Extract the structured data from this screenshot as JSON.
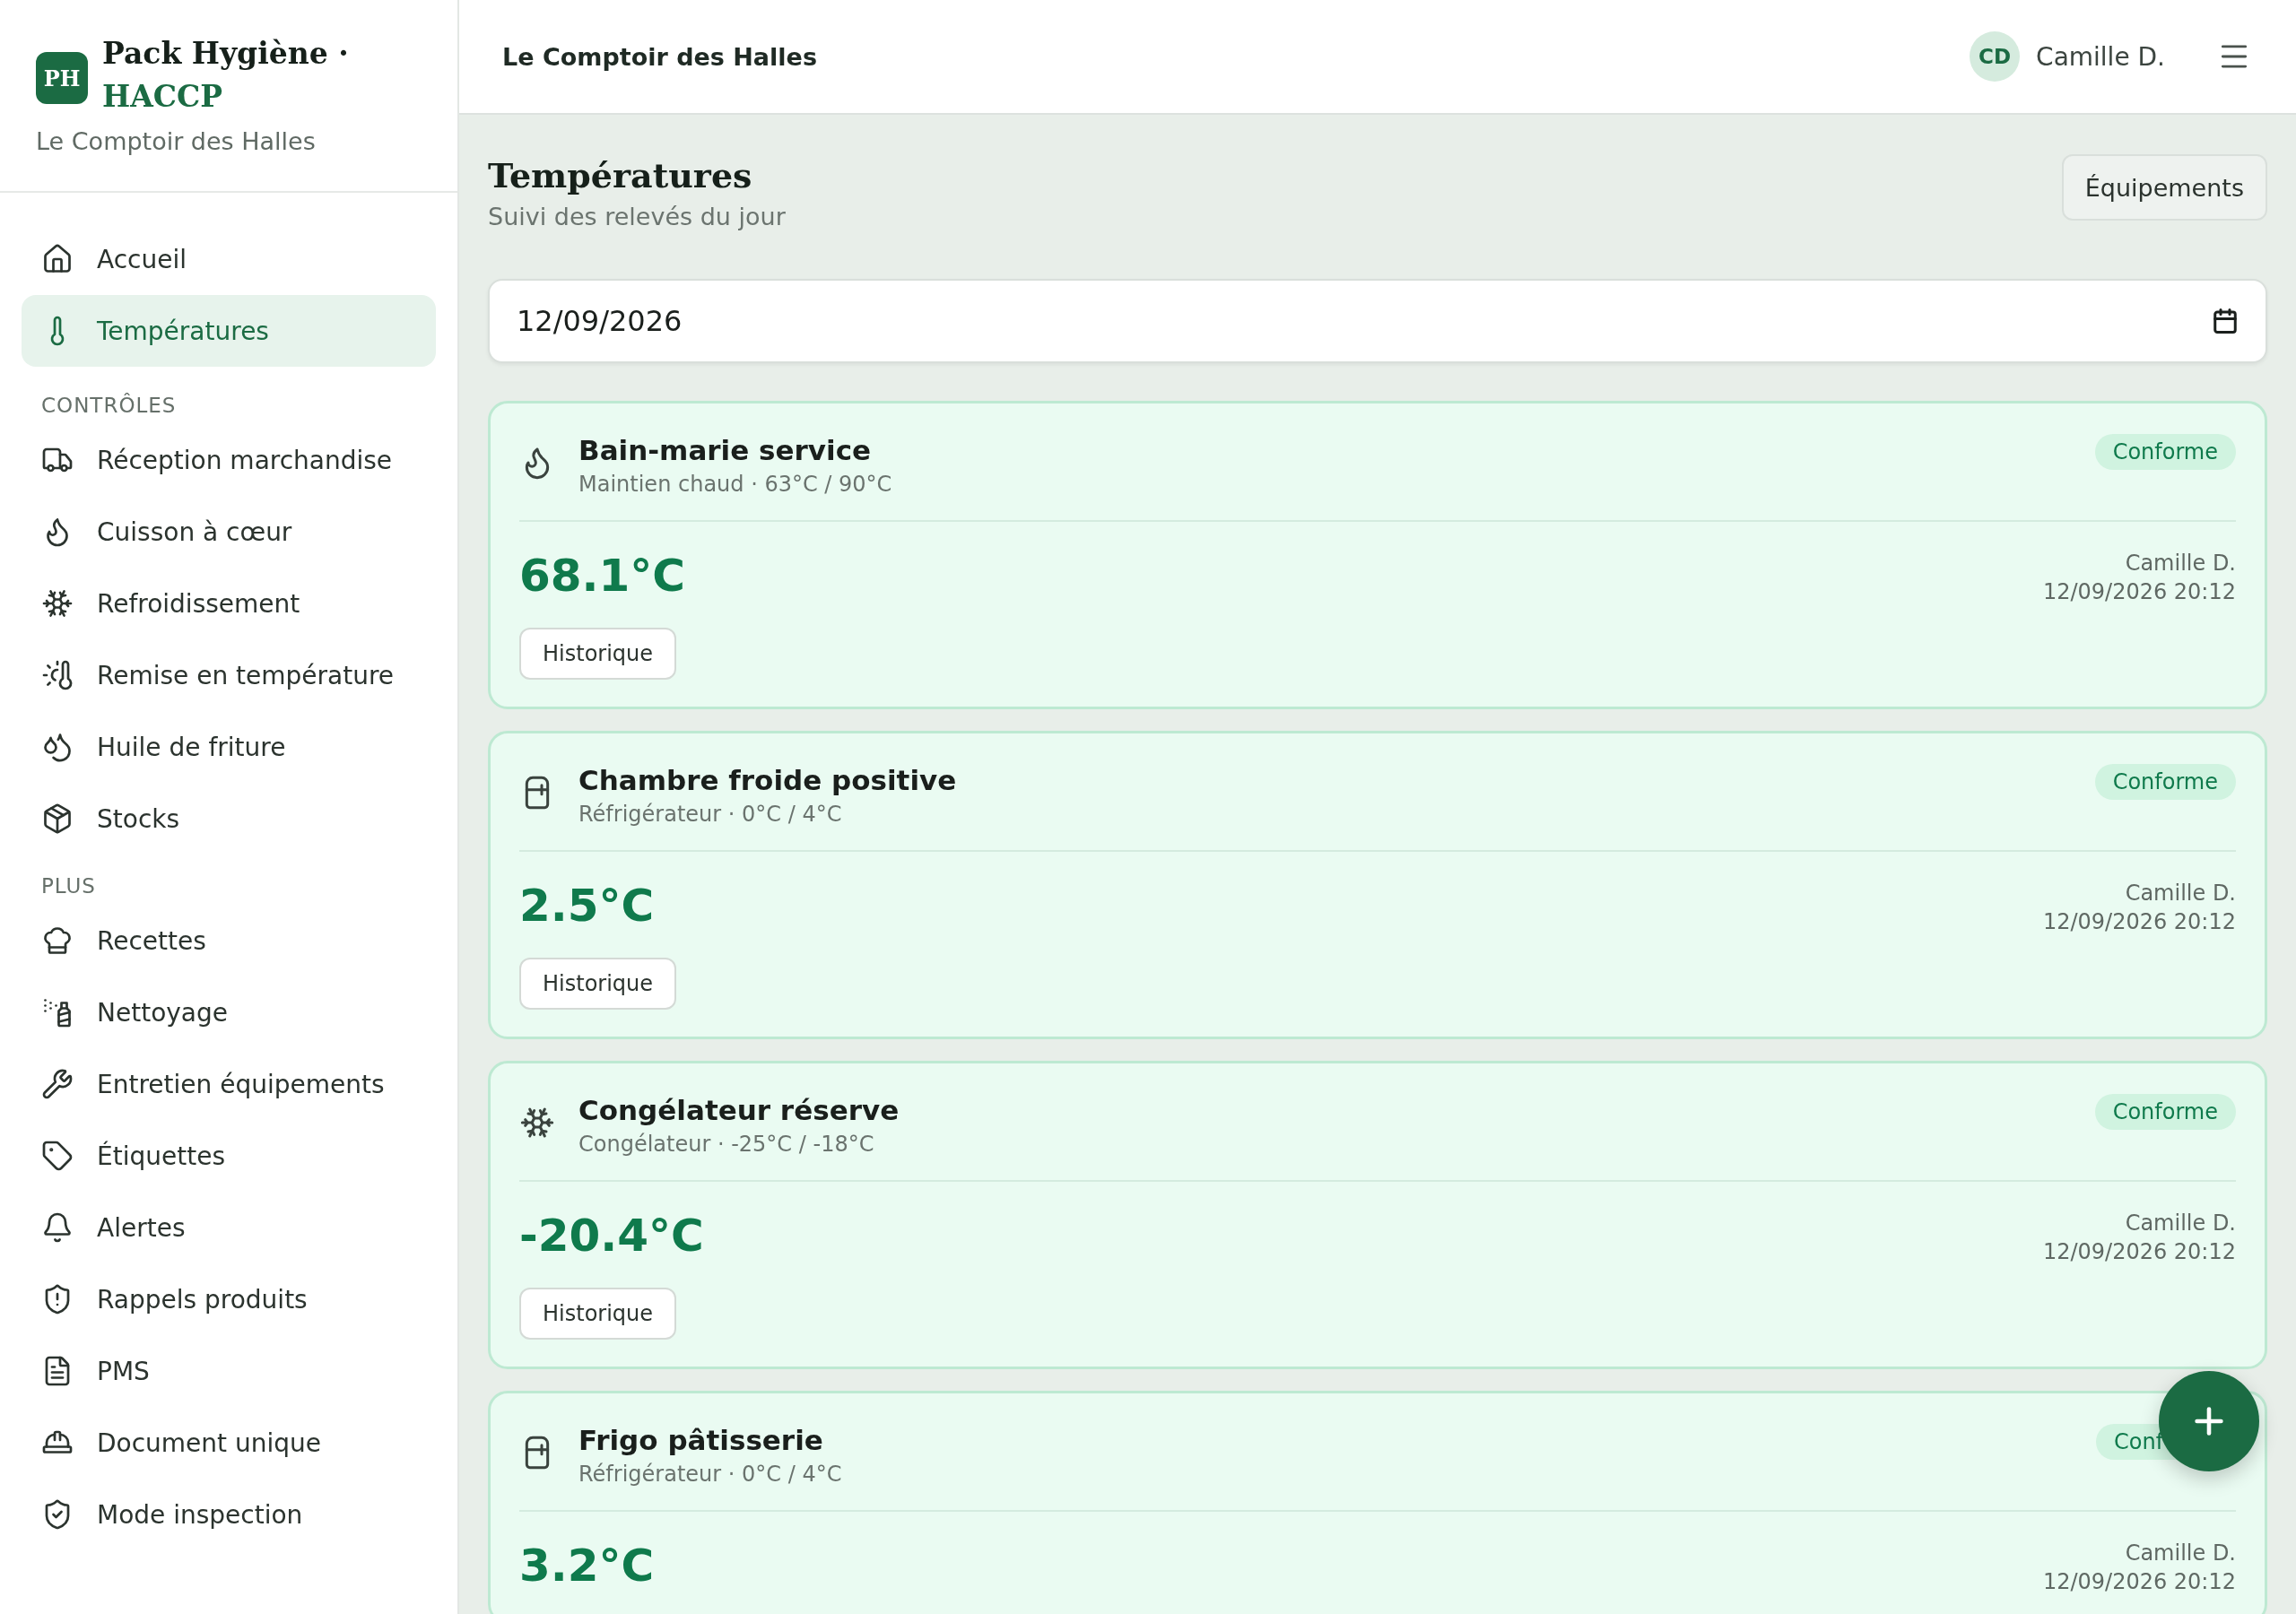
{
  "brand": {
    "logo": "PH",
    "title": "Pack Hygiène ·",
    "subtitle": "HACCP",
    "site": "Le Comptoir des Halles"
  },
  "nav": [
    {
      "label": "Accueil",
      "selected": false
    },
    {
      "label": "Températures",
      "selected": true
    }
  ],
  "sections": [
    {
      "title": "CONTRÔLES",
      "items": [
        {
          "label": "Réception marchandise",
          "selected": false
        },
        {
          "label": "Cuisson à cœur",
          "selected": false
        },
        {
          "label": "Refroidissement",
          "selected": false
        },
        {
          "label": "Remise en température",
          "selected": false
        },
        {
          "label": "Huile de friture",
          "selected": false
        },
        {
          "label": "Stocks",
          "selected": false
        }
      ]
    },
    {
      "title": "PLUS",
      "items": [
        {
          "label": "Recettes",
          "selected": false
        },
        {
          "label": "Nettoyage",
          "selected": false
        },
        {
          "label": "Entretien équipements",
          "selected": false
        },
        {
          "label": "Étiquettes",
          "selected": false
        },
        {
          "label": "Alertes",
          "selected": false
        },
        {
          "label": "Rappels produits",
          "selected": false
        },
        {
          "label": "PMS",
          "selected": false
        },
        {
          "label": "Document unique",
          "selected": false
        },
        {
          "label": "Mode inspection",
          "selected": false
        }
      ]
    }
  ],
  "header": {
    "title": "Le Comptoir des Halles",
    "avatar": "CD",
    "user": "Camille D."
  },
  "page": {
    "title": "Températures",
    "subtitle": "Suivi des relevés du jour",
    "button": "Équipements",
    "date": "12/09/2026"
  },
  "cards": [
    {
      "kind": "hot",
      "name": "Bain-marie service",
      "detail": "Maintien chaud · 63°C / 90°C",
      "status": "Conforme",
      "value": "68.1°C",
      "user": "Camille D.",
      "time": "12/09/2026 20:12",
      "button": "Historique"
    },
    {
      "kind": "fridge",
      "name": "Chambre froide positive",
      "detail": "Réfrigérateur · 0°C / 4°C",
      "status": "Conforme",
      "value": "2.5°C",
      "user": "Camille D.",
      "time": "12/09/2026 20:12",
      "button": "Historique"
    },
    {
      "kind": "freezer",
      "name": "Congélateur réserve",
      "detail": "Congélateur · -25°C / -18°C",
      "status": "Conforme",
      "value": "-20.4°C",
      "user": "Camille D.",
      "time": "12/09/2026 20:12",
      "button": "Historique"
    },
    {
      "kind": "fridge",
      "name": "Frigo pâtisserie",
      "detail": "Réfrigérateur · 0°C / 4°C",
      "status": "Conf",
      "value": "3.2°C",
      "user": "Camille D.",
      "time": "12/09/2026 20:12"
    }
  ]
}
